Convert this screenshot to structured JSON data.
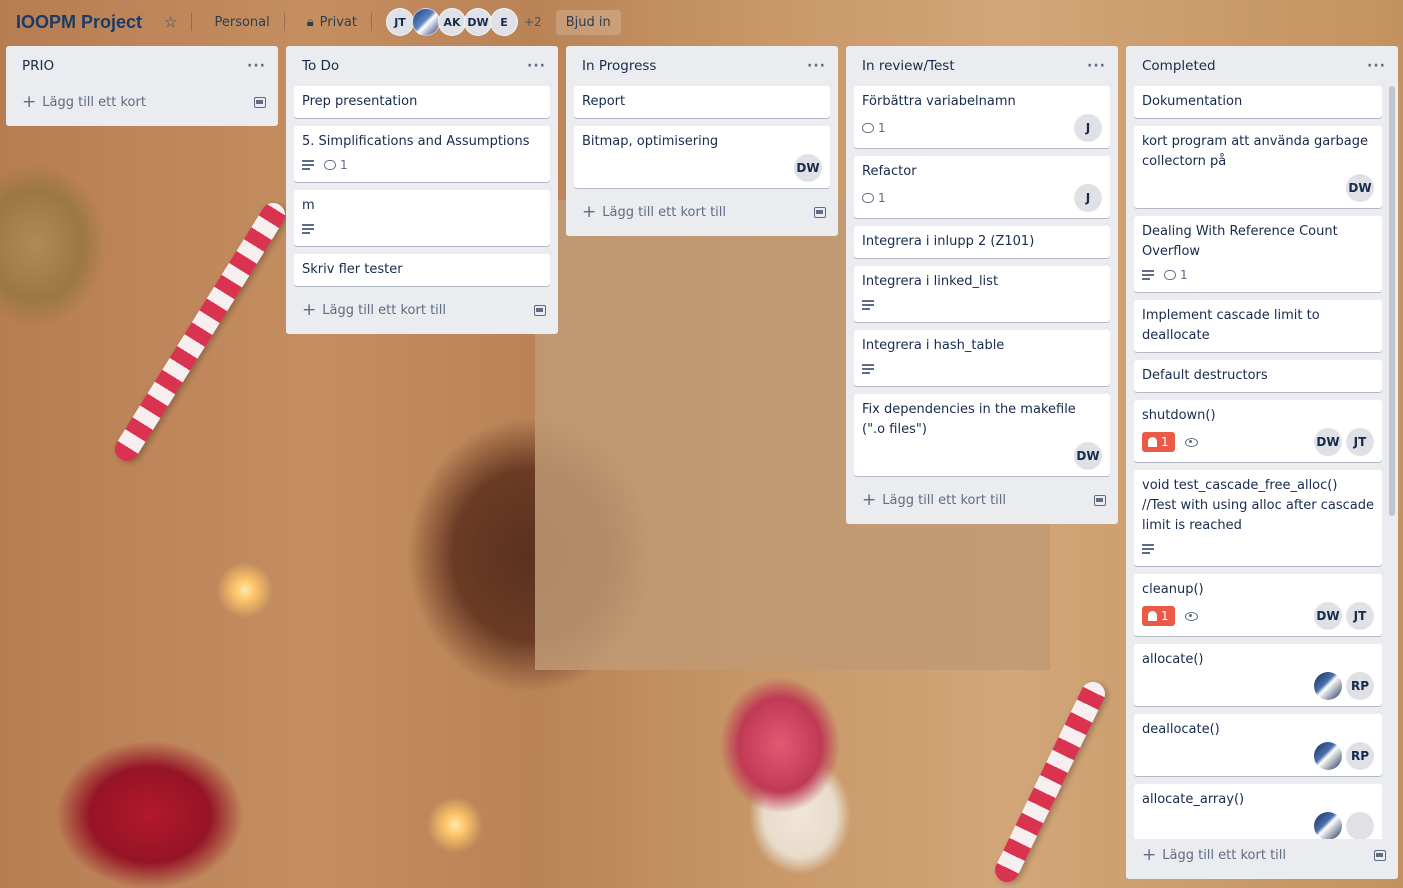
{
  "header": {
    "board_title": "IOOPM Project",
    "workspace": "Personal",
    "visibility": "Privat",
    "members": [
      "JT",
      "AK",
      "DW",
      "E"
    ],
    "more_members": "+2",
    "invite_label": "Bjud in"
  },
  "lists": [
    {
      "title": "PRIO",
      "add_label": "Lägg till ett kort",
      "cards": []
    },
    {
      "title": "To Do",
      "add_label": "Lägg till ett kort till",
      "cards": [
        {
          "title": "Prep presentation"
        },
        {
          "title": "5. Simplifications and Assumptions",
          "comments": "1"
        },
        {
          "title": "m"
        },
        {
          "title": "Skriv fler tester"
        }
      ]
    },
    {
      "title": "In Progress",
      "add_label": "Lägg till ett kort till",
      "cards": [
        {
          "title": "Report"
        },
        {
          "title": "Bitmap, optimisering",
          "members": [
            "DW"
          ]
        }
      ]
    },
    {
      "title": "In review/Test",
      "add_label": "Lägg till ett kort till",
      "cards": [
        {
          "title": "Förbättra variabelnamn",
          "comments": "1",
          "members": [
            "J"
          ]
        },
        {
          "title": "Refactor",
          "comments": "1",
          "members": [
            "J"
          ]
        },
        {
          "title": "Integrera i inlupp 2 (Z101)"
        },
        {
          "title": "Integrera i linked_list"
        },
        {
          "title": "Integrera i hash_table"
        },
        {
          "title": "Fix dependencies in the makefile (\".o files\")",
          "members": [
            "DW"
          ]
        }
      ]
    },
    {
      "title": "Completed",
      "add_label": "Lägg till ett kort till",
      "cards": [
        {
          "title": "Dokumentation"
        },
        {
          "title": "kort program att använda garbage collectorn på",
          "members": [
            "DW"
          ]
        },
        {
          "title": "Dealing With Reference Count Overflow",
          "comments": "1"
        },
        {
          "title": "Implement cascade limit to deallocate"
        },
        {
          "title": "Default destructors"
        },
        {
          "title": "shutdown()",
          "due_count": "1",
          "members": [
            "DW",
            "JT"
          ]
        },
        {
          "title": "void test_cascade_free_alloc() //Test with using alloc after cascade limit is reached"
        },
        {
          "title": "cleanup()",
          "due_count": "1",
          "members": [
            "DW",
            "JT"
          ]
        },
        {
          "title": "allocate()",
          "members": [
            "RP"
          ]
        },
        {
          "title": "deallocate()",
          "members": [
            "RP"
          ]
        },
        {
          "title": "allocate_array()"
        }
      ]
    }
  ],
  "colors": {
    "list_bg": "#ebecf0",
    "due_badge": "#eb5a46",
    "title_text": "#1a3b66"
  }
}
